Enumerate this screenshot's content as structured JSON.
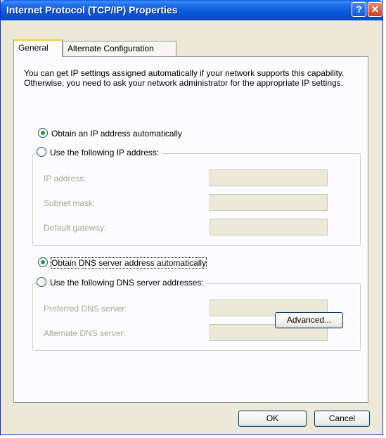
{
  "window": {
    "title": "Internet Protocol (TCP/IP) Properties",
    "help_glyph": "?",
    "close_glyph": "✕"
  },
  "tabs": [
    {
      "label": "General"
    },
    {
      "label": "Alternate Configuration"
    }
  ],
  "intro_text": "You can get IP settings assigned automatically if your network supports this capability. Otherwise, you need to ask your network administrator for the appropriate IP settings.",
  "ip": {
    "auto_label": "Obtain an IP address automatically",
    "manual_label": "Use the following IP address:",
    "selected": "auto",
    "fields": [
      {
        "label": "IP address:",
        "value": ""
      },
      {
        "label": "Subnet mask:",
        "value": ""
      },
      {
        "label": "Default gateway:",
        "value": ""
      }
    ]
  },
  "dns": {
    "auto_label": "Obtain DNS server address automatically",
    "manual_label": "Use the following DNS server addresses:",
    "selected": "auto",
    "fields": [
      {
        "label": "Preferred DNS server:",
        "value": ""
      },
      {
        "label": "Alternate DNS server:",
        "value": ""
      }
    ]
  },
  "buttons": {
    "advanced": "Advanced...",
    "ok": "OK",
    "cancel": "Cancel"
  }
}
